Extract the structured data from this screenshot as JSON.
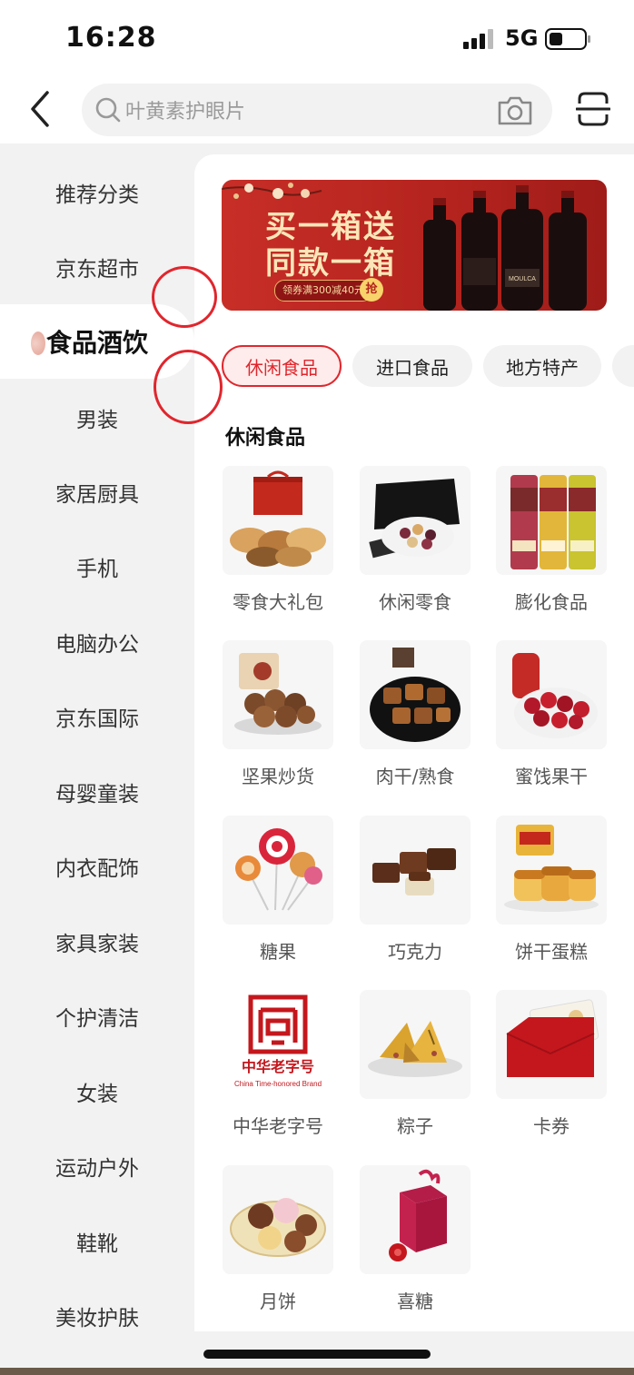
{
  "status_bar": {
    "time": "16:28",
    "network": "5G"
  },
  "search": {
    "placeholder": "叶黄素护眼片"
  },
  "sidebar": {
    "items": [
      {
        "label": "推荐分类"
      },
      {
        "label": "京东超市"
      },
      {
        "label": "食品酒饮",
        "active": true
      },
      {
        "label": "男装"
      },
      {
        "label": "家居厨具"
      },
      {
        "label": "手机"
      },
      {
        "label": "电脑办公"
      },
      {
        "label": "京东国际"
      },
      {
        "label": "母婴童装"
      },
      {
        "label": "内衣配饰"
      },
      {
        "label": "家具家装"
      },
      {
        "label": "个护清洁"
      },
      {
        "label": "女装"
      },
      {
        "label": "运动户外"
      },
      {
        "label": "鞋靴"
      },
      {
        "label": "美妆护肤"
      }
    ]
  },
  "banner": {
    "line1": "买一箱送",
    "line2": "同款一箱",
    "coupon": "领券满300减40元",
    "grab": "抢",
    "brand": "MOULCA"
  },
  "tabs": [
    {
      "label": "休闲食品",
      "active": true
    },
    {
      "label": "进口食品"
    },
    {
      "label": "地方特产"
    }
  ],
  "section": {
    "title": "休闲食品",
    "items": [
      {
        "label": "零食大礼包",
        "icon": "snack-gift-box"
      },
      {
        "label": "休闲零食",
        "icon": "mixed-nuts-box"
      },
      {
        "label": "膨化食品",
        "icon": "chips-cans"
      },
      {
        "label": "坚果炒货",
        "icon": "macadamia-nuts"
      },
      {
        "label": "肉干/熟食",
        "icon": "beef-jerky"
      },
      {
        "label": "蜜饯果干",
        "icon": "dried-cranberries"
      },
      {
        "label": "糖果",
        "icon": "lollipops"
      },
      {
        "label": "巧克力",
        "icon": "chocolate-pieces"
      },
      {
        "label": "饼干蛋糕",
        "icon": "sponge-cakes"
      },
      {
        "label": "中华老字号",
        "icon": "china-time-honored-brand-logo",
        "logo_text": "中华老字号",
        "logo_subtext": "China Time-honored Brand"
      },
      {
        "label": "粽子",
        "icon": "zongzi"
      },
      {
        "label": "卡券",
        "icon": "gift-card-envelope"
      },
      {
        "label": "月饼",
        "icon": "mooncakes"
      },
      {
        "label": "喜糖",
        "icon": "wedding-candy-box"
      }
    ]
  },
  "colors": {
    "accent": "#e0262d",
    "sidebar_bg": "#f2f2f2",
    "banner_red": "#b4231e"
  }
}
